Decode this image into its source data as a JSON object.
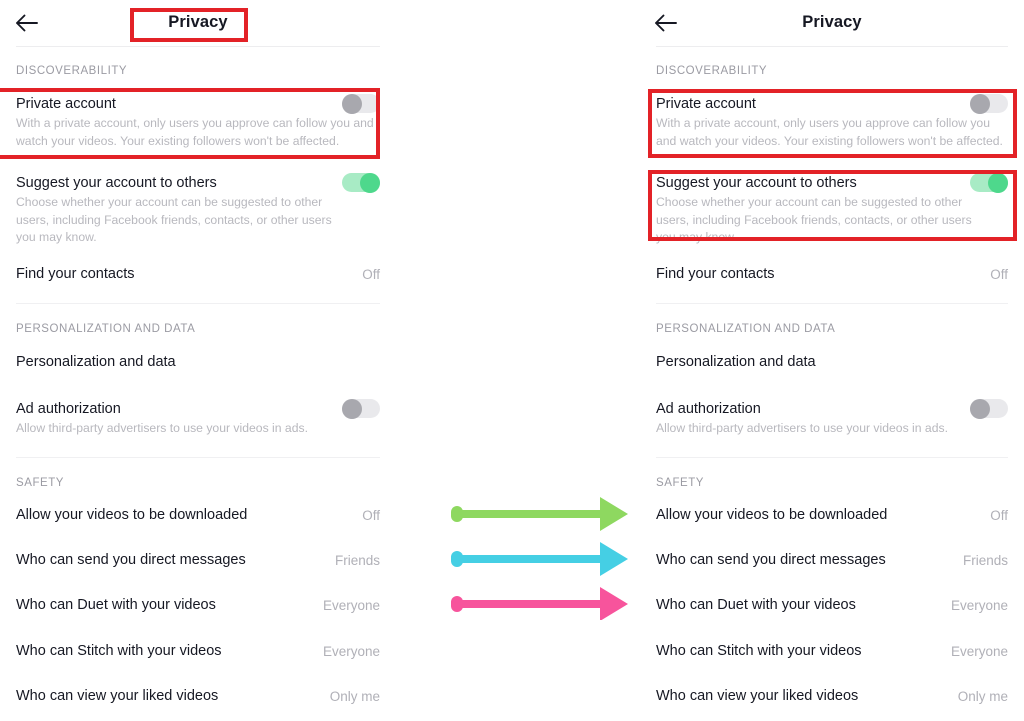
{
  "screen": {
    "back_icon": "back-arrow-icon",
    "title": "Privacy"
  },
  "sections": [
    {
      "id": "discoverability",
      "label": "DISCOVERABILITY",
      "rows": [
        {
          "id": "private-account",
          "title": "Private account",
          "desc": "With a private account, only users you approve can follow you and watch your videos. Your existing followers won't be affected.",
          "control": "toggle",
          "toggle_state": "off"
        },
        {
          "id": "suggest-account",
          "title": "Suggest your account to others",
          "desc": "Choose whether your account can be suggested to other users, including Facebook friends, contacts, or other users you may know.",
          "control": "toggle",
          "toggle_state": "on"
        },
        {
          "id": "find-your-contacts",
          "title": "Find your contacts",
          "control": "value",
          "value": "Off"
        }
      ]
    },
    {
      "id": "personalization-and-data",
      "label": "PERSONALIZATION AND DATA",
      "rows": [
        {
          "id": "personalization-and-data",
          "title": "Personalization and data",
          "control": "none",
          "value": ""
        },
        {
          "id": "ad-authorization",
          "title": "Ad authorization",
          "desc": "Allow third-party advertisers to use your videos in ads.",
          "control": "toggle",
          "toggle_state": "off"
        }
      ]
    },
    {
      "id": "safety",
      "label": "SAFETY",
      "rows": [
        {
          "id": "allow-videos-downloaded",
          "title": "Allow your videos to be downloaded",
          "control": "value",
          "value": "Off"
        },
        {
          "id": "who-can-send-direct-messages",
          "title": "Who can send you direct messages",
          "control": "value",
          "value": "Friends"
        },
        {
          "id": "who-can-duet",
          "title": "Who can Duet with your videos",
          "control": "value",
          "value": "Everyone"
        },
        {
          "id": "who-can-stitch",
          "title": "Who can Stitch with your videos",
          "control": "value",
          "value": "Everyone"
        },
        {
          "id": "who-can-view-liked-videos",
          "title": "Who can view your liked videos",
          "control": "value",
          "value": "Only me"
        }
      ]
    }
  ],
  "annotations": {
    "highlight_color": "#e32227",
    "boxes": [
      {
        "id": "highlight-title-left",
        "name": "highlight-box-privacy-title"
      },
      {
        "id": "highlight-private-account-left",
        "name": "highlight-box-private-account-left"
      },
      {
        "id": "highlight-private-account-right",
        "name": "highlight-box-private-account-right"
      },
      {
        "id": "highlight-suggest-right",
        "name": "highlight-box-suggest-account-right"
      }
    ],
    "arrows": [
      {
        "id": "arrow-1",
        "color": "#8ed860",
        "name": "green-arrow"
      },
      {
        "id": "arrow-2",
        "color": "#45cfe4",
        "name": "cyan-arrow"
      },
      {
        "id": "arrow-3",
        "color": "#f7549c",
        "name": "pink-arrow"
      }
    ]
  },
  "toggle_colors": {
    "off_track": "#e9e9ec",
    "off_knob": "#a8a8ae",
    "on_track": "#a8ebc5",
    "on_knob": "#4ed88c"
  }
}
